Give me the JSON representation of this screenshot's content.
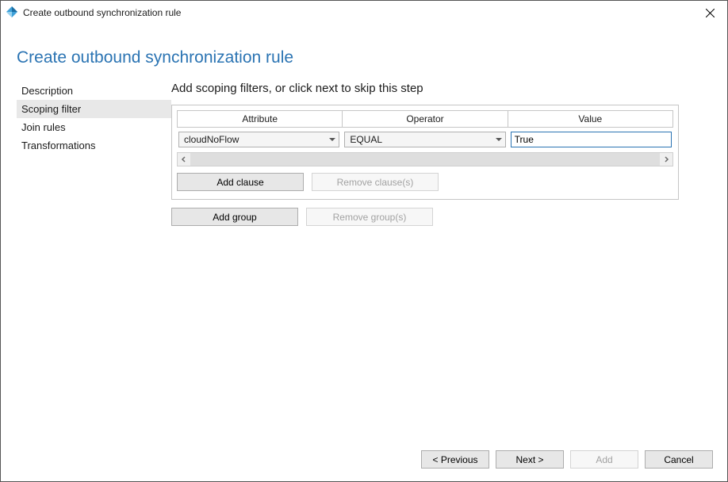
{
  "window": {
    "title": "Create outbound synchronization rule"
  },
  "page": {
    "heading": "Create outbound synchronization rule",
    "instruction": "Add scoping filters, or click next to skip this step"
  },
  "sidebar": {
    "items": [
      {
        "label": "Description",
        "selected": false
      },
      {
        "label": "Scoping filter",
        "selected": true
      },
      {
        "label": "Join rules",
        "selected": false
      },
      {
        "label": "Transformations",
        "selected": false
      }
    ]
  },
  "filter": {
    "headers": {
      "attribute": "Attribute",
      "operator": "Operator",
      "value": "Value"
    },
    "row": {
      "attribute": "cloudNoFlow",
      "operator": "EQUAL",
      "value": "True"
    },
    "buttons": {
      "add_clause": "Add clause",
      "remove_clause": "Remove clause(s)",
      "add_group": "Add group",
      "remove_group": "Remove group(s)"
    }
  },
  "footer": {
    "previous": "< Previous",
    "next": "Next >",
    "add": "Add",
    "cancel": "Cancel"
  }
}
